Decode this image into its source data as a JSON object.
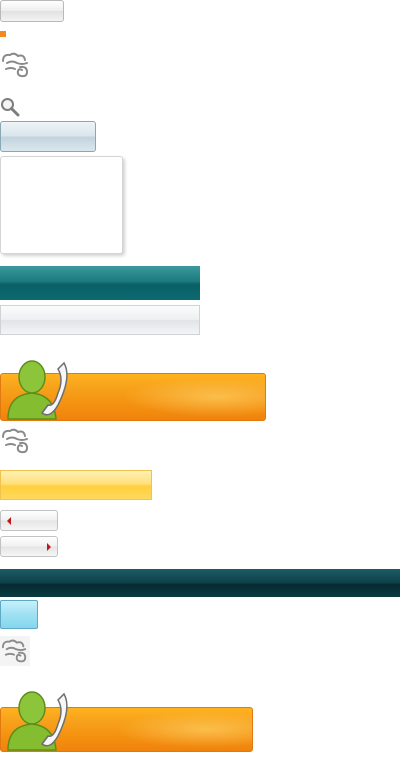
{
  "elements": {
    "small_button": {
      "icon": "blank-button"
    },
    "marker": {
      "color": "#f08a1c"
    },
    "cloud_icon": {
      "icon": "cloud-swirl-icon"
    },
    "search_icon": {
      "icon": "magnifier-icon"
    },
    "contact_icon": {
      "icon": "person-with-phone-icon"
    },
    "arrow_left": {
      "icon": "red-left-arrow"
    },
    "arrow_right": {
      "icon": "red-right-arrow"
    }
  },
  "colors": {
    "accent_orange": "#f59412",
    "teal": "#0a5f66",
    "dark_teal": "#052a30",
    "cyan": "#9fe1f4",
    "yellow": "#ffcf3d",
    "arrow_red": "#c0181a"
  }
}
